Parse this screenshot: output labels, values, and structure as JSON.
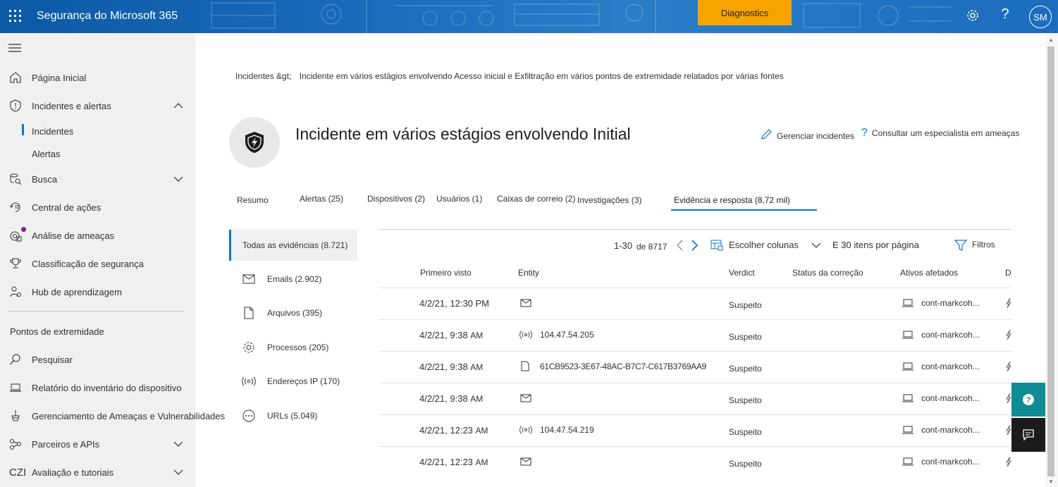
{
  "topbar": {
    "app_title": "Segurança do Microsoft 365",
    "diagnostics_label": "Diagnostics",
    "avatar_initials": "SM",
    "help_glyph": "?",
    "icons": [
      "waffle-icon",
      "gear-icon",
      "help-icon"
    ]
  },
  "sidebar": {
    "items": [
      {
        "label": "Página Inicial",
        "icon": "home-icon"
      },
      {
        "label": "Incidentes e alertas",
        "icon": "shield-icon",
        "expanded": true
      },
      {
        "label": "Busca",
        "icon": "search-hunt-icon"
      },
      {
        "label": "Central de ações",
        "icon": "action-center-icon"
      },
      {
        "label": "Análise de ameaças",
        "icon": "threat-analytics-icon"
      },
      {
        "label": "Classificação de segurança",
        "icon": "trophy-icon"
      },
      {
        "label": "Hub de aprendizagem",
        "icon": "learning-icon"
      }
    ],
    "sub_items": [
      {
        "label": "Incidentes",
        "selected": true
      },
      {
        "label": "Alertas"
      }
    ],
    "section_title": "Pontos de extremidade",
    "section_items": [
      {
        "label": "Pesquisar",
        "icon": "search-icon"
      },
      {
        "label": "Relatório do inventário do dispositivo",
        "icon": "laptop-icon"
      },
      {
        "label": "Gerenciamento de Ameaças e Vulnerabilidades",
        "icon": "tvm-icon"
      },
      {
        "label": "Parceiros e APIs",
        "icon": "partners-icon"
      },
      {
        "label": "Avaliação e tutoriais",
        "icon": "czi-icon",
        "icon_text": "CZI"
      }
    ]
  },
  "breadcrumb": {
    "root": "Incidentes &gt;",
    "current": "Incidente em vários estágios envolvendo Acesso inicial e Exfiltração em vários pontos de extremidade relatados por várias fontes"
  },
  "incident": {
    "title": "Incidente em vários estágios envolvendo Initial",
    "manage_label": "Gerenciar incidentes",
    "consult_label": "Consultar um especialista em ameaças"
  },
  "tabs": [
    {
      "label": "Resumo"
    },
    {
      "label": "Alertas (25)"
    },
    {
      "label": "Dispositivos (2)"
    },
    {
      "label": "Usuários (1)"
    },
    {
      "label": "Caixas de correio (2)"
    },
    {
      "label": "Investigações (3)"
    },
    {
      "label": "Evidência e resposta (8,72 mil)",
      "selected": true
    }
  ],
  "evidence_categories": [
    {
      "label": "Todas as evidências (8.721)",
      "selected": true
    },
    {
      "label": "Emails (2.902)",
      "icon": "mail-icon"
    },
    {
      "label": "Arquivos (395)",
      "icon": "file-icon"
    },
    {
      "label": "Processos (205)",
      "icon": "gear-icon"
    },
    {
      "label": "Endereços IP (170)",
      "icon": "ip-icon"
    },
    {
      "label": "URLs (5.049)",
      "icon": "url-icon"
    }
  ],
  "toolbar": {
    "range": "1-30",
    "of_total": "de 8717",
    "choose_columns": "Escolher colunas",
    "per_page": "E 30 itens por página",
    "filters": "Filtros"
  },
  "columns": [
    "Primeiro visto",
    "Entity",
    "Verdict",
    "Status da correção",
    "Ativos afetados",
    "D"
  ],
  "rows": [
    {
      "date": "4/2/21, 12:30 PM",
      "time_suffix": "",
      "entity_icon": "mail-icon",
      "entity": "",
      "verdict": "Suspeito",
      "asset": "cont-markcoh..."
    },
    {
      "date": "4/2/21, 9:38",
      "time_suffix": "AM",
      "entity_icon": "ip-icon",
      "entity": "104.47.54.205",
      "verdict": "Suspeito",
      "asset": "cont-markcoh..."
    },
    {
      "date": "4/2/21, 9:38",
      "time_suffix": "AM",
      "entity_icon": "file-icon",
      "entity": "61CB9523-3E67-48AC-B7C7-C617B3769AA9",
      "verdict": "Suspeito",
      "asset": "cont-markcoh..."
    },
    {
      "date": "4/2/21, 9:38",
      "time_suffix": "AM",
      "entity_icon": "mail-icon",
      "entity": "",
      "verdict": "Suspeito",
      "asset": "cont-markcoh..."
    },
    {
      "date": "4/2/21, 12:23",
      "time_suffix": "AM",
      "entity_icon": "ip-icon",
      "entity": "104.47.54.219",
      "verdict": "Suspeito",
      "asset": "cont-markcoh..."
    },
    {
      "date": "4/2/21, 12:23",
      "time_suffix": "AM",
      "entity_icon": "mail-icon",
      "entity": "",
      "verdict": "Suspeito",
      "asset": "cont-markcoh..."
    }
  ],
  "colors": {
    "topbar": "#1769b8",
    "diagnostics": "#f7a400",
    "accent": "#0078d4",
    "sidebar_bg": "#f0f0f0",
    "help_fab": "#0e8b93",
    "chat_fab": "#1b1b1b"
  }
}
